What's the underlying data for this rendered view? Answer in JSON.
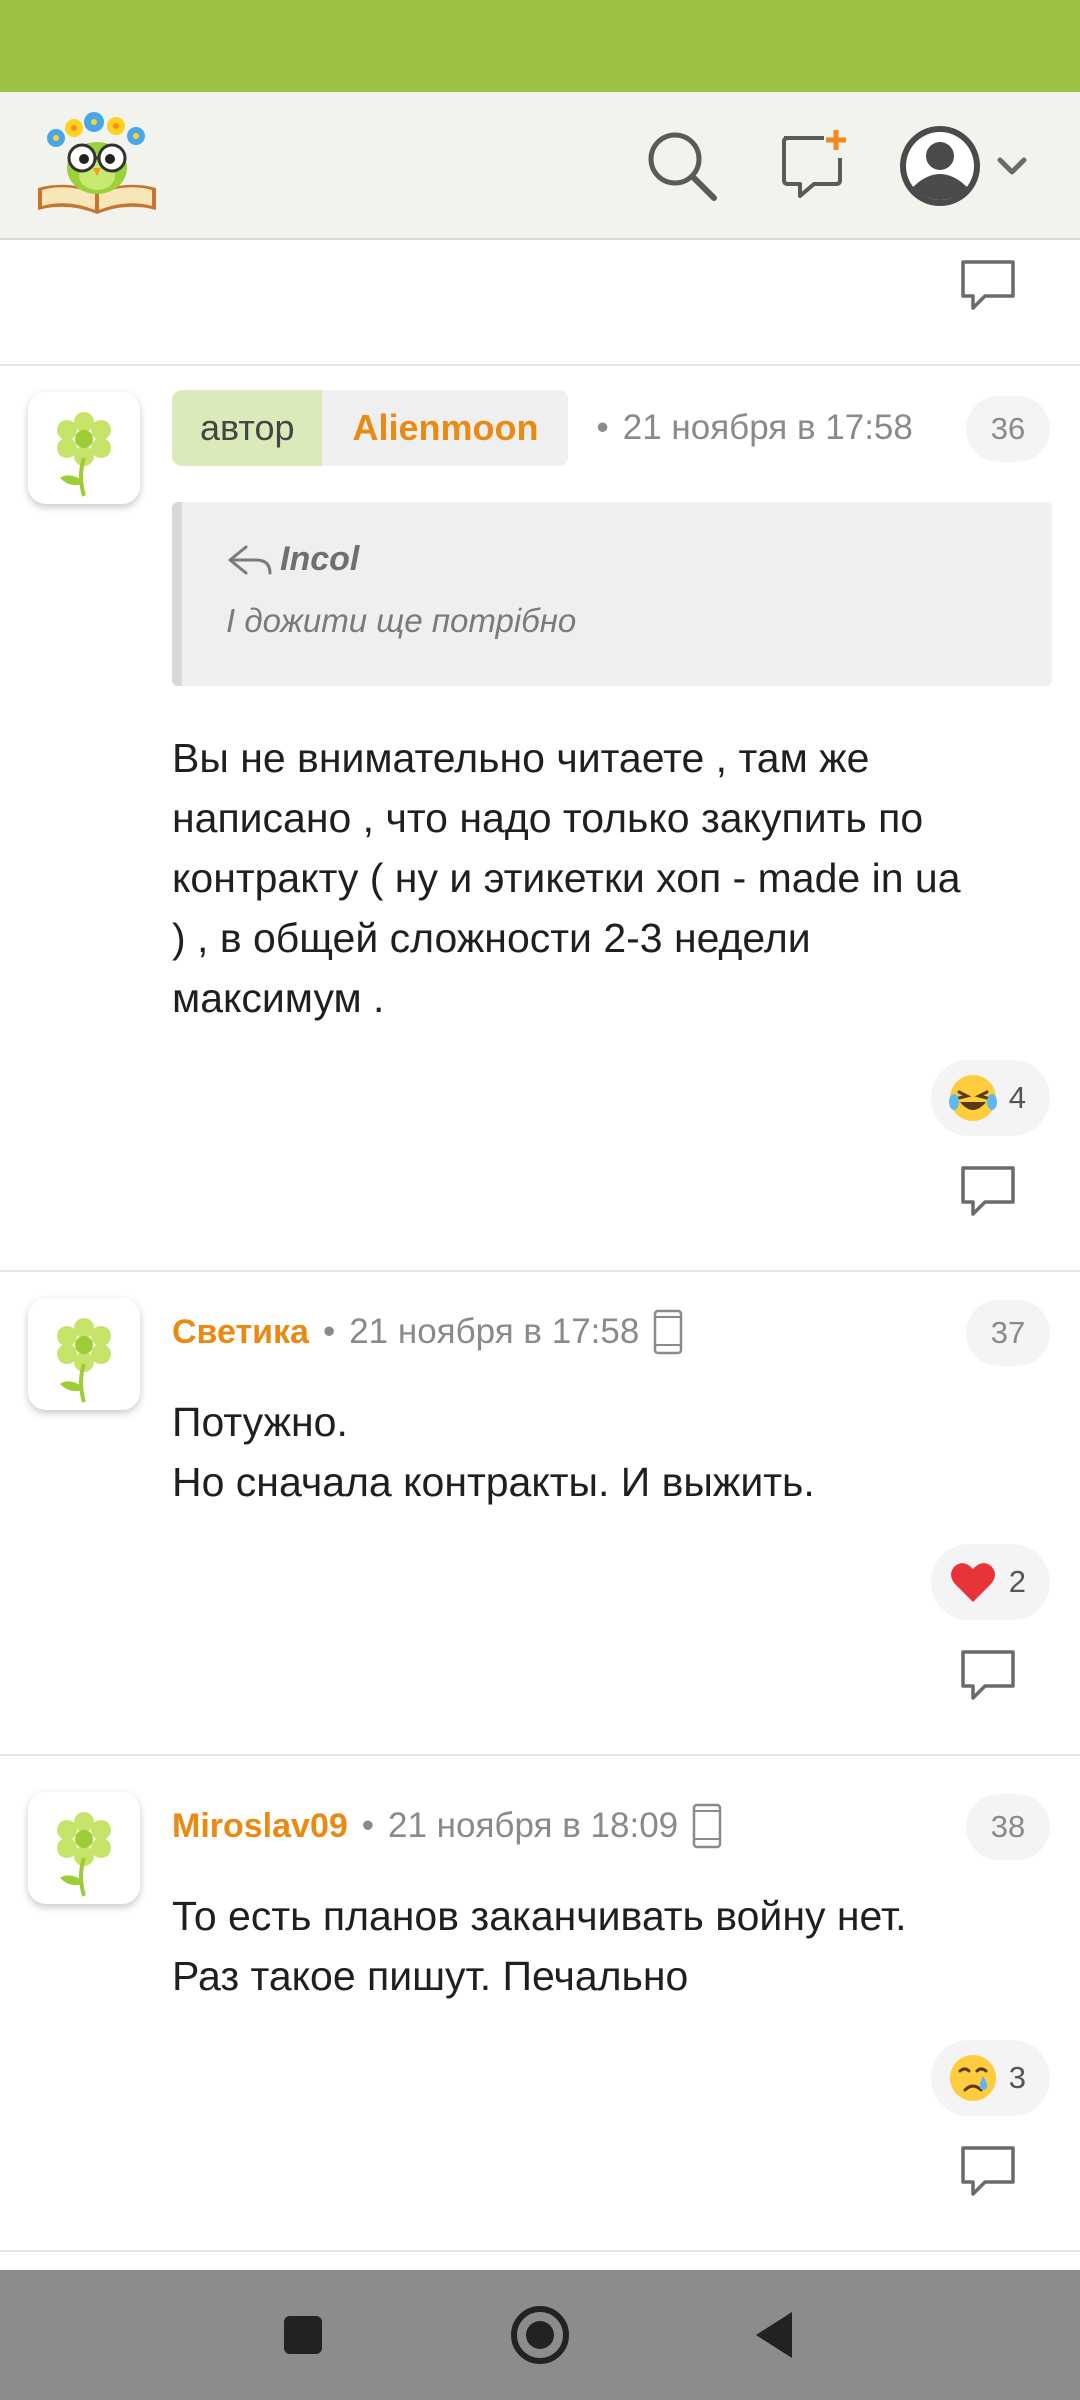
{
  "header": {
    "logo": "owl-books-logo",
    "search_icon": "search-icon",
    "new_post_icon": "new-post-icon",
    "profile_icon": "profile-avatar-icon",
    "profile_menu_icon": "chevron-down-icon"
  },
  "colors": {
    "brand_green": "#9dc243",
    "username_orange": "#e98a12",
    "author_tag_green": "#dbeabb"
  },
  "comments": [
    {
      "number": "36",
      "author_role": "автор",
      "author": "Alienmoon",
      "date": "21 ноября в 17:58",
      "quote": {
        "author": "Incol",
        "text": "І дожити ще потрібно"
      },
      "text": "Вы не внимательно читаете , там же\nнаписано , что надо только закупить по\nконтракту ( ну и этикетки хоп - made in ua\n) , в общей сложности 2-3 недели\nмаксимум .",
      "reaction": {
        "emoji": "laughing-tears-emoji",
        "count": "4"
      }
    },
    {
      "number": "37",
      "author": "Светика",
      "date": "21 ноября в 17:58",
      "device": "mobile-phone-icon",
      "text": "Потужно.\nНо сначала контракты. И выжить.",
      "reaction": {
        "emoji": "red-heart-emoji",
        "count": "2"
      }
    },
    {
      "number": "38",
      "author": "Miroslav09",
      "date": "21 ноября в 18:09",
      "device": "mobile-phone-icon",
      "text": "То есть планов заканчивать войну нет.\nРаз такое пишут. Печально",
      "reaction": {
        "emoji": "crying-face-emoji",
        "count": "3"
      }
    }
  ],
  "nav": {
    "recents_icon": "square-icon",
    "home_icon": "circle-home-icon",
    "back_icon": "triangle-back-icon"
  }
}
